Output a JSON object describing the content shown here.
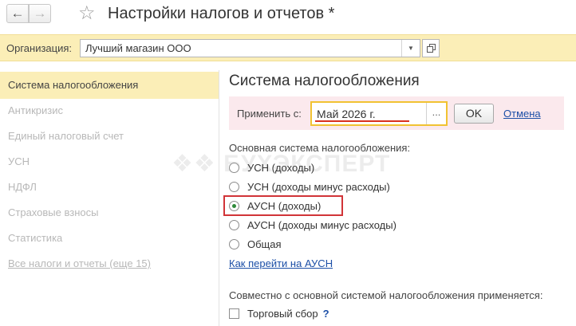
{
  "window": {
    "title": "Настройки налогов и отчетов *"
  },
  "organization": {
    "label": "Организация:",
    "value": "Лучший магазин ООО"
  },
  "nav": {
    "items": [
      {
        "label": "Система налогообложения",
        "active": true
      },
      {
        "label": "Антикризис"
      },
      {
        "label": "Единый налоговый счет"
      },
      {
        "label": "УСН"
      },
      {
        "label": "НДФЛ"
      },
      {
        "label": "Страховые взносы"
      },
      {
        "label": "Статистика"
      },
      {
        "label": "Все налоги и отчеты (еще 15)",
        "link": true
      }
    ]
  },
  "main": {
    "title": "Система налогообложения",
    "apply": {
      "label": "Применить с:",
      "value": "Май 2026 г.",
      "picker": "...",
      "ok": "OK",
      "cancel": "Отмена"
    },
    "system": {
      "label": "Основная система налогообложения:",
      "options": [
        {
          "label": "УСН (доходы)",
          "checked": false
        },
        {
          "label": "УСН (доходы минус расходы)",
          "checked": false
        },
        {
          "label": "АУСН (доходы)",
          "checked": true
        },
        {
          "label": "АУСН (доходы минус расходы)",
          "checked": false
        },
        {
          "label": "Общая",
          "checked": false
        }
      ],
      "howto_link": "Как перейти на АУСН"
    },
    "joint": {
      "label": "Совместно с основной системой налогообложения применяется:",
      "trade_fee": "Торговый сбор",
      "help": "?"
    }
  },
  "watermark": "БУХЭКСПЕРТ",
  "colors": {
    "accent_yellow": "#fbeeb7",
    "apply_bg": "#fbe9ed",
    "link": "#1c4fa7",
    "highlight": "#d13438"
  }
}
